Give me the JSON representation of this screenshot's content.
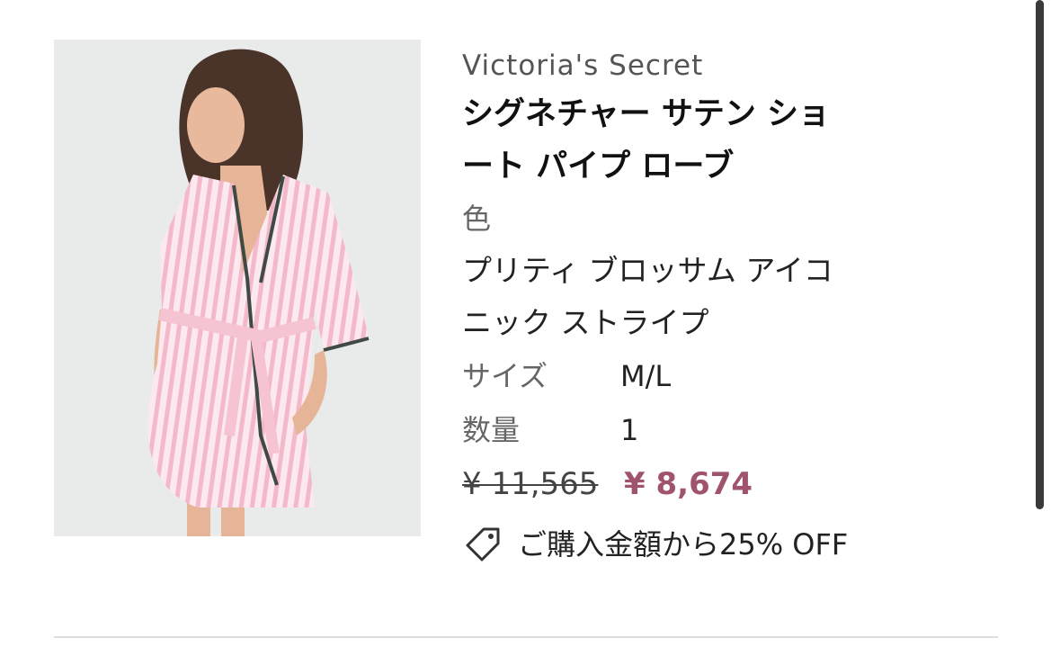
{
  "product": {
    "brand": "Victoria's Secret",
    "title_line1": "シグネチャー サテン ショ",
    "title_line2": "ート パイプ ローブ",
    "color_label": "色",
    "color_value_line1": "プリティ ブロッサム アイコ",
    "color_value_line2": "ニック ストライプ",
    "size_label": "サイズ",
    "size_value": "M/L",
    "qty_label": "数量",
    "qty_value": "1",
    "original_price": "¥ 11,565",
    "sale_price": "¥ 8,674",
    "promo_text": "ご購入金額から25% OFF",
    "promo_icon": "tag-icon",
    "image_subject": "striped-satin-robe-photo"
  },
  "colors": {
    "sale_price": "#a0536f",
    "robe_pink": "#f3c6d3",
    "image_bg": "#e9ebea"
  }
}
